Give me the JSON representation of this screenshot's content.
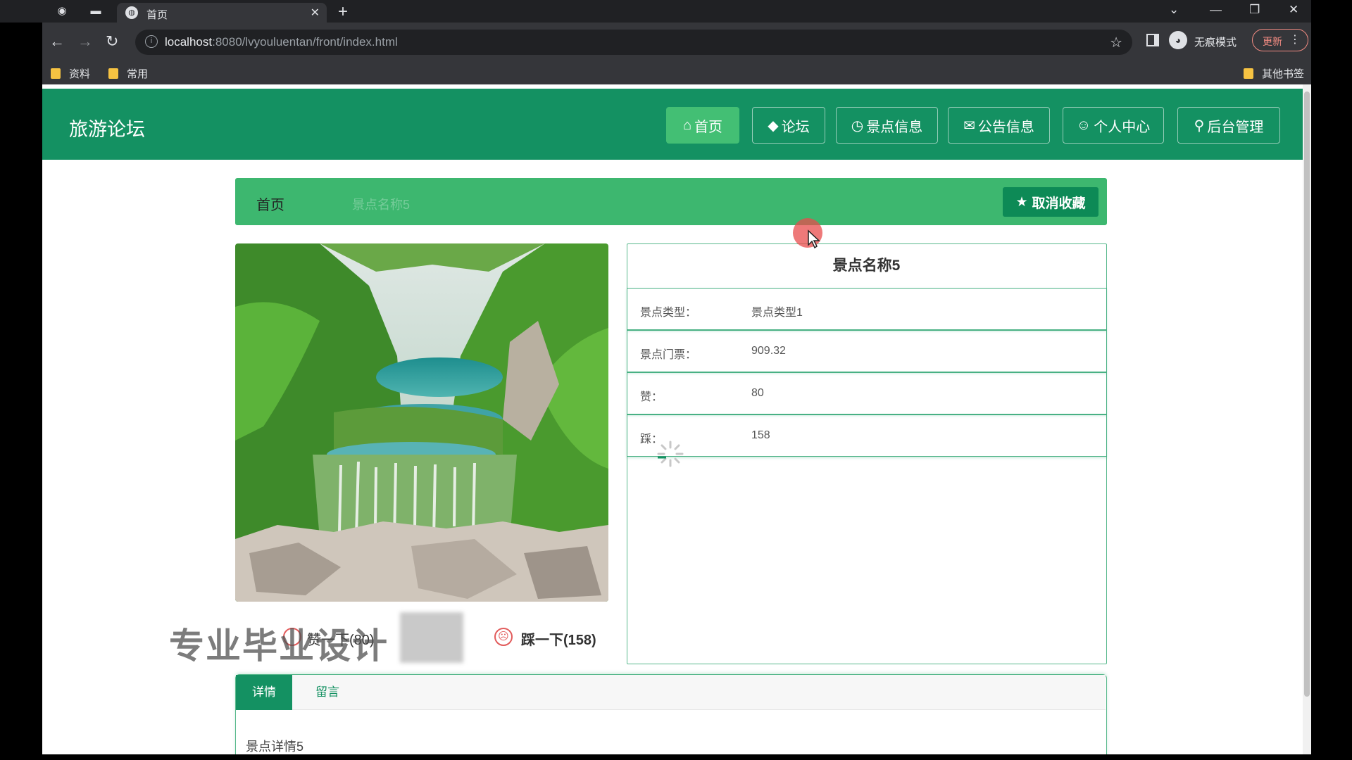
{
  "browser": {
    "tab_title": "首页",
    "url_host": "localhost",
    "url_rest": ":8080/lvyouluentan/front/index.html",
    "incognito_label": "无痕模式",
    "update_label": "更新",
    "bookmarks": [
      {
        "label": "资料"
      },
      {
        "label": "常用"
      }
    ],
    "other_bookmarks": "其他书签"
  },
  "site": {
    "logo": "旅游论坛",
    "nav": [
      {
        "icon": "⌂",
        "label": "首页",
        "active": true
      },
      {
        "icon": "◆",
        "label": "论坛"
      },
      {
        "icon": "◷",
        "label": "景点信息"
      },
      {
        "icon": "✉",
        "label": "公告信息"
      },
      {
        "icon": "☺",
        "label": "个人中心"
      },
      {
        "icon": "⚲",
        "label": "后台管理"
      }
    ]
  },
  "breadcrumb": {
    "home": "首页",
    "current": "景点名称5"
  },
  "favorite_button": {
    "icon": "★",
    "label": "取消收藏"
  },
  "scenic": {
    "name": "景点名称5",
    "rows": [
      {
        "key": "景点类型：",
        "value": "景点类型1"
      },
      {
        "key": "景点门票：",
        "value": "909.32"
      },
      {
        "key": "赞：",
        "value": "80"
      },
      {
        "key": "踩：",
        "value": "158"
      }
    ]
  },
  "votes": {
    "like_label": "赞一下(80)",
    "dislike_label": "踩一下(158)"
  },
  "watermark": "专业毕业设计",
  "tabs": {
    "detail": "详情",
    "comment": "留言",
    "detail_text": "景点详情5"
  },
  "colors": {
    "header_green": "#149162",
    "crumb_green": "#3db76f",
    "active_nav": "#43bf74"
  }
}
